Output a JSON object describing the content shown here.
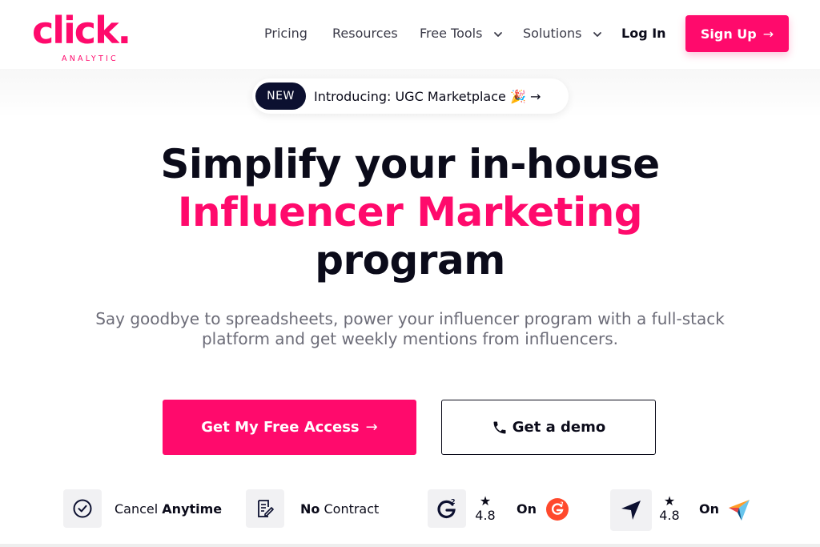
{
  "brand": {
    "logo_word": "click.",
    "logo_sub": "ANALYTIC",
    "accent_color": "#ff0a6c",
    "dark_color": "#0c1030"
  },
  "nav": {
    "items": [
      {
        "label": "Pricing",
        "has_dropdown": false
      },
      {
        "label": "Resources",
        "has_dropdown": false
      },
      {
        "label": "Free Tools",
        "has_dropdown": true
      },
      {
        "label": "Solutions",
        "has_dropdown": true
      }
    ],
    "login_label": "Log In",
    "signup_label": "Sign Up"
  },
  "announcement": {
    "badge": "NEW",
    "text": "Introducing: UGC Marketplace 🎉 →"
  },
  "hero": {
    "line1": "Simplify your in-house",
    "line2": "Influencer Marketing",
    "line3": "program",
    "subtitle_line1": "Say goodbye to spreadsheets, power your influencer program with a full-stack",
    "subtitle_line2": "platform and get weekly mentions from influencers.",
    "cta_primary": "Get My Free Access",
    "cta_secondary": "Get a demo"
  },
  "trust": {
    "cancel": {
      "prefix": "Cancel ",
      "bold": "Anytime",
      "icon": "check-circle-icon"
    },
    "contract": {
      "bold": "No",
      "suffix": " Contract",
      "icon": "document-edit-icon"
    },
    "g2": {
      "star": "★",
      "rating": "4.8",
      "on": "On",
      "icon": "g2-logo-icon"
    },
    "capterra": {
      "star": "★",
      "rating": "4.8",
      "on": "On",
      "icon": "capterra-logo-icon"
    }
  }
}
